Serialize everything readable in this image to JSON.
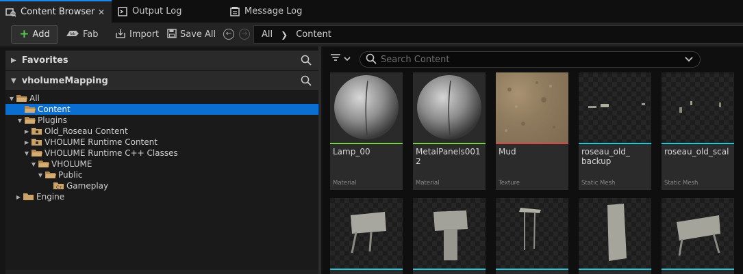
{
  "tabs": [
    {
      "label": "Content Browser",
      "active": true
    },
    {
      "label": "Output Log",
      "active": false
    },
    {
      "label": "Message Log",
      "active": false
    }
  ],
  "toolbar": {
    "add_label": "Add",
    "fab_label": "Fab",
    "import_label": "Import",
    "save_all_label": "Save All"
  },
  "breadcrumb": {
    "root": "All",
    "current": "Content"
  },
  "sections": {
    "favorites": "Favorites",
    "project": "vholumeMapping"
  },
  "tree": [
    {
      "label": "All",
      "expanded": true,
      "selected": false
    },
    {
      "label": "Content",
      "expanded": false,
      "selected": true
    },
    {
      "label": "Plugins",
      "expanded": true,
      "selected": false
    },
    {
      "label": "Old_Roseau Content",
      "expanded": false,
      "selected": false
    },
    {
      "label": "VHOLUME Runtime Content",
      "expanded": false,
      "selected": false
    },
    {
      "label": "VHOLUME Runtime C++ Classes",
      "expanded": true,
      "selected": false
    },
    {
      "label": "VHOLUME",
      "expanded": true,
      "selected": false
    },
    {
      "label": "Public",
      "expanded": true,
      "selected": false
    },
    {
      "label": "Gameplay",
      "expanded": false,
      "selected": false
    },
    {
      "label": "Engine",
      "expanded": false,
      "selected": false
    }
  ],
  "search": {
    "placeholder": "Search Content"
  },
  "assets": [
    {
      "name": "Lamp_00",
      "type": "Material",
      "accent": "#7ad04a"
    },
    {
      "name": "MetalPanels0012",
      "type": "Material",
      "accent": "#7ad04a"
    },
    {
      "name": "Mud",
      "type": "Texture",
      "accent": "#d04a4a"
    },
    {
      "name": "roseau_old_\nbackup",
      "type": "Static Mesh",
      "accent": "#25c7d6"
    },
    {
      "name": "roseau_old_scal",
      "type": "Static Mesh",
      "accent": "#25c7d6"
    },
    {
      "name": "",
      "type": "",
      "accent": "#25c7d6"
    },
    {
      "name": "",
      "type": "",
      "accent": "#25c7d6"
    },
    {
      "name": "",
      "type": "",
      "accent": "#25c7d6"
    },
    {
      "name": "",
      "type": "",
      "accent": "#25c7d6"
    },
    {
      "name": "",
      "type": "",
      "accent": "#25c7d6"
    }
  ],
  "colors": {
    "selection": "#0b6fd1",
    "tab_accent": "#1e8bea",
    "add_plus": "#57c84d",
    "folder": "#c9a36a"
  },
  "icons": {
    "content_browser_tab": "content-browser-icon",
    "output_log_tab": "output-log-icon",
    "message_log_tab": "message-log-icon",
    "search": "search-icon",
    "filter": "filter-icon",
    "folder": "folder-icon"
  }
}
